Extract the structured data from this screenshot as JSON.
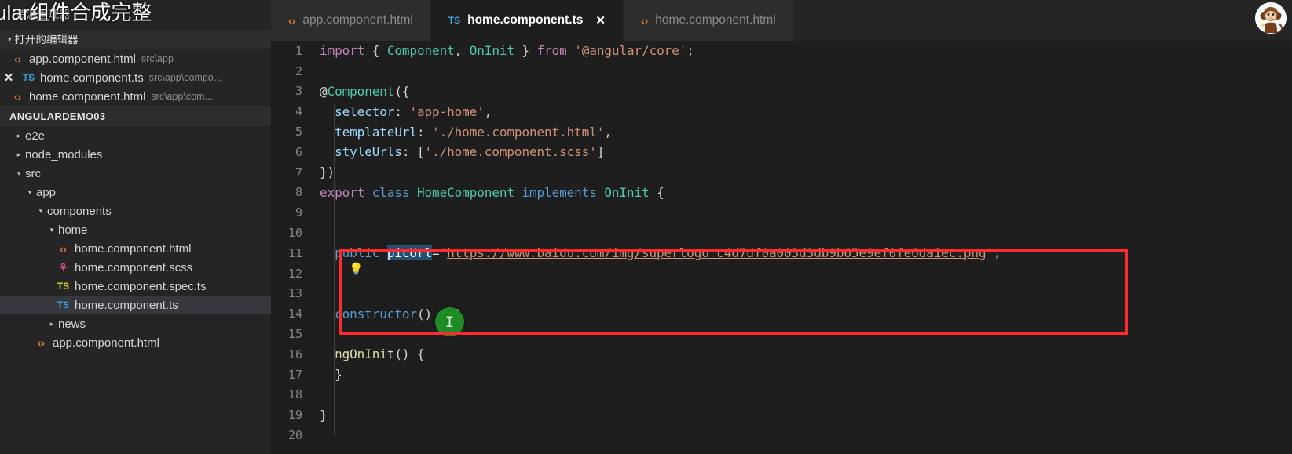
{
  "overlay": {
    "caption": "ular组件合成完整",
    "avatar_icon": "monkey-avatar"
  },
  "sidebar": {
    "title": "资源管理器",
    "open_editors": {
      "label": "打开的编辑器",
      "caret": "▾",
      "items": [
        {
          "icon": "html-icon",
          "icon_glyph": "‹›",
          "name": "app.component.html",
          "path": "src\\app",
          "dirty": false,
          "selected": false
        },
        {
          "icon": "ts-icon",
          "icon_glyph": "TS",
          "name": "home.component.ts",
          "path": "src\\app\\compo...",
          "dirty": true,
          "close_glyph": "✕",
          "selected": false
        },
        {
          "icon": "html-icon",
          "icon_glyph": "‹›",
          "name": "home.component.html",
          "path": "src\\app\\com...",
          "dirty": false,
          "selected": false
        }
      ]
    },
    "project": {
      "name": "ANGULARDEMO03",
      "tree": [
        {
          "depth": 1,
          "type": "folder",
          "expanded": false,
          "arrow": "▸",
          "name": "e2e"
        },
        {
          "depth": 1,
          "type": "folder",
          "expanded": false,
          "arrow": "▸",
          "name": "node_modules"
        },
        {
          "depth": 1,
          "type": "folder",
          "expanded": true,
          "arrow": "▾",
          "name": "src"
        },
        {
          "depth": 2,
          "type": "folder",
          "expanded": true,
          "arrow": "▾",
          "name": "app"
        },
        {
          "depth": 3,
          "type": "folder",
          "expanded": true,
          "arrow": "▾",
          "name": "components"
        },
        {
          "depth": 4,
          "type": "folder",
          "expanded": true,
          "arrow": "▾",
          "name": "home"
        },
        {
          "depth": 5,
          "type": "file",
          "icon": "html-icon",
          "icon_glyph": "‹›",
          "name": "home.component.html",
          "selected": false
        },
        {
          "depth": 5,
          "type": "file",
          "icon": "scss-icon",
          "icon_glyph": "⚘",
          "name": "home.component.scss",
          "selected": false
        },
        {
          "depth": 5,
          "type": "file",
          "icon": "ts-spec-icon",
          "icon_glyph": "TS",
          "name": "home.component.spec.ts",
          "selected": false
        },
        {
          "depth": 5,
          "type": "file",
          "icon": "ts-icon",
          "icon_glyph": "TS",
          "name": "home.component.ts",
          "selected": true
        },
        {
          "depth": 4,
          "type": "folder",
          "expanded": false,
          "arrow": "▸",
          "name": "news"
        },
        {
          "depth": 3,
          "type": "file",
          "icon": "html-icon",
          "icon_glyph": "‹›",
          "name": "app.component.html",
          "selected": false
        }
      ]
    }
  },
  "editor": {
    "tabs": [
      {
        "icon": "html-icon",
        "icon_glyph": "‹›",
        "label": "app.component.html",
        "active": false,
        "closable": false
      },
      {
        "icon": "ts-icon",
        "icon_glyph": "TS",
        "label": "home.component.ts",
        "active": true,
        "closable": true,
        "close_glyph": "✕"
      },
      {
        "icon": "html-icon",
        "icon_glyph": "‹›",
        "label": "home.component.html",
        "active": false,
        "closable": false
      }
    ],
    "line_numbers": [
      "1",
      "2",
      "3",
      "4",
      "5",
      "6",
      "7",
      "8",
      "9",
      "10",
      "11",
      "12",
      "13",
      "14",
      "15",
      "16",
      "17",
      "18",
      "19",
      "20"
    ],
    "code_lines": [
      "import { Component, OnInit } from '@angular/core';",
      "",
      "@Component({",
      "  selector: 'app-home',",
      "  templateUrl: './home.component.html',",
      "  styleUrls: ['./home.component.scss']",
      "})",
      "export class HomeComponent implements OnInit {",
      "",
      "",
      "  public picUrl='https://www.baidu.com/img/superlogo_c4d7df0a003d3db9b65e9ef0fe6da1ec.png';",
      "",
      "",
      "  constructor() { }",
      "",
      "  ngOnInit() {",
      "  }",
      "",
      "}",
      ""
    ],
    "selected_token": "picUrl",
    "url_value": "https://www.baidu.com/img/superlogo_c4d7df0a003d3db9b65e9ef0fe6da1ec.png",
    "lightbulb_icon": "lightbulb-icon",
    "cursor_badge_icon": "text-cursor-icon",
    "cursor_badge_glyph": "I",
    "highlight_color": "#ff2b2b"
  }
}
